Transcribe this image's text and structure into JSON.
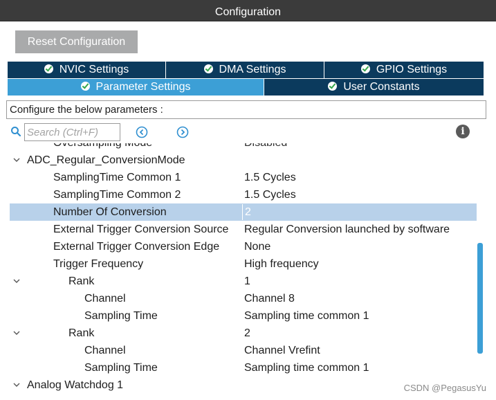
{
  "window": {
    "title": "Configuration"
  },
  "toolbar": {
    "reset_label": "Reset Configuration"
  },
  "tabs": {
    "row1": [
      {
        "label": "NVIC Settings"
      },
      {
        "label": "DMA Settings"
      },
      {
        "label": "GPIO Settings"
      }
    ],
    "row2": [
      {
        "label": "Parameter Settings",
        "active": true
      },
      {
        "label": "User Constants"
      }
    ]
  },
  "description": "Configure the below parameters :",
  "search": {
    "placeholder": "Search (Ctrl+F)",
    "value": ""
  },
  "icons": {
    "search": "search-icon",
    "prev": "arrow-left-circle-icon",
    "next": "arrow-right-circle-icon",
    "info": "info-icon"
  },
  "params": {
    "clipped": {
      "name": "Oversampling Mode",
      "value": "Disabled"
    },
    "group_regular": "ADC_Regular_ConversionMode",
    "rows": [
      {
        "name": "SamplingTime Common 1",
        "value": "1.5 Cycles"
      },
      {
        "name": "SamplingTime Common 2",
        "value": "1.5 Cycles"
      },
      {
        "name": "Number Of Conversion",
        "value": "2"
      },
      {
        "name": "External Trigger Conversion Source",
        "value": "Regular Conversion launched by software"
      },
      {
        "name": "External Trigger Conversion Edge",
        "value": "None"
      },
      {
        "name": "Trigger Frequency",
        "value": "High frequency"
      }
    ],
    "ranks": [
      {
        "label": "Rank",
        "value": "1",
        "channel_label": "Channel",
        "channel": "Channel 8",
        "sampling_label": "Sampling Time",
        "sampling": "Sampling time common 1"
      },
      {
        "label": "Rank",
        "value": "2",
        "channel_label": "Channel",
        "channel": "Channel Vrefint",
        "sampling_label": "Sampling Time",
        "sampling": "Sampling time common 1"
      }
    ],
    "group_watchdog": "Analog Watchdog 1"
  },
  "colors": {
    "accent": "#3c9fd6",
    "tab_dark": "#0b3a5d",
    "selection": "#b8d1ea",
    "check": "#35a64a"
  },
  "watermark": "CSDN @PegasusYu"
}
